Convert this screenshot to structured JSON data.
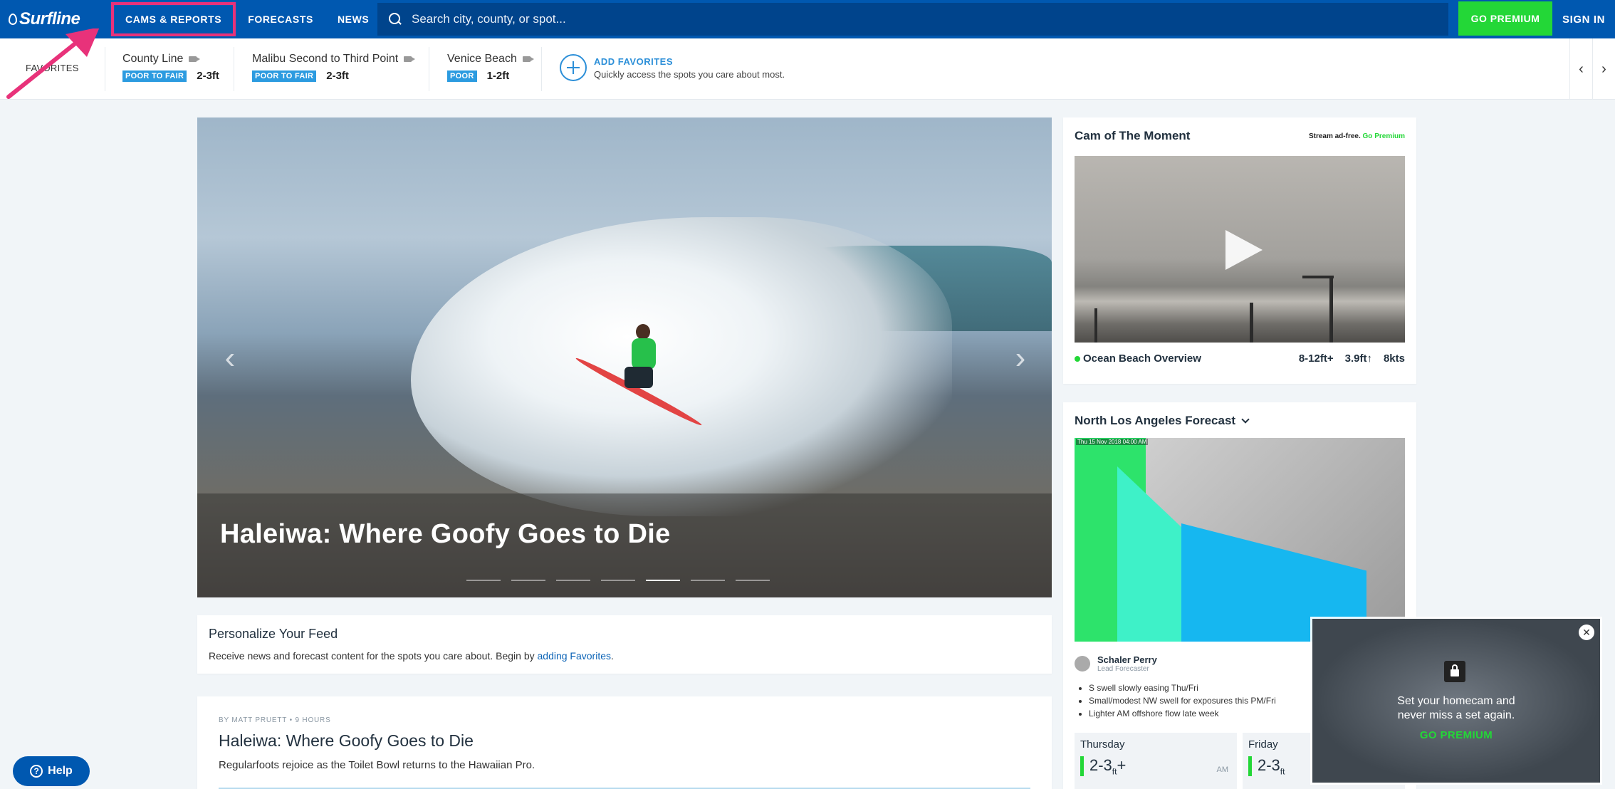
{
  "nav": {
    "logo": "Surfline",
    "links": [
      "CAMS & REPORTS",
      "FORECASTS",
      "NEWS"
    ],
    "search_placeholder": "Search city, county, or spot...",
    "premium": "GO PREMIUM",
    "signin": "SIGN IN"
  },
  "favorites": {
    "label": "FAVORITES",
    "spots": [
      {
        "name": "County Line",
        "condition": "POOR TO FAIR",
        "height": "2-3ft"
      },
      {
        "name": "Malibu Second to Third Point",
        "condition": "POOR TO FAIR",
        "height": "2-3ft"
      },
      {
        "name": "Venice Beach",
        "condition": "POOR",
        "height": "1-2ft"
      }
    ],
    "add_title": "ADD FAVORITES",
    "add_sub": "Quickly access the spots you care about most."
  },
  "hero": {
    "title": "Haleiwa: Where Goofy Goes to Die",
    "slide_count": 7,
    "active_slide": 5
  },
  "personalize": {
    "title": "Personalize Your Feed",
    "text": "Receive news and forecast content for the spots you care about. Begin by ",
    "link": "adding Favorites",
    "end": "."
  },
  "article": {
    "byline": "BY MATT PRUETT • 9 HOURS",
    "title": "Haleiwa: Where Goofy Goes to Die",
    "sub": "Regularfoots rejoice as the Toilet Bowl returns to the Hawaiian Pro."
  },
  "cam": {
    "title": "Cam of The Moment",
    "ad_text": "Stream ad-free.",
    "ad_link": "Go Premium",
    "spot": "Ocean Beach Overview",
    "surf": "8-12ft+",
    "swell": "3.9ft",
    "wind": "8kts"
  },
  "forecast": {
    "title": "North Los Angeles Forecast",
    "map_stamp": "Thu 15 Nov 2018 04:00 AM",
    "forecaster": "Schaler Perry",
    "role": "Lead Forecaster",
    "bullets": [
      "S swell slowly easing Thu/Fri",
      "Small/modest NW swell for exposures this PM/Fri",
      "Lighter AM offshore flow late week"
    ],
    "days": [
      {
        "name": "Thursday",
        "height": "2-3",
        "unit": "ft",
        "plus": "+",
        "time": "AM"
      },
      {
        "name": "Friday",
        "height": "2-3",
        "unit": "ft",
        "plus": "",
        "time": ""
      }
    ]
  },
  "popup": {
    "line1": "Set your homecam and",
    "line2": "never miss a set again.",
    "cta": "GO PREMIUM"
  },
  "help": {
    "label": "Help"
  },
  "colors": {
    "brand_blue": "#0058b0",
    "premium_green": "#23d737",
    "condition_blue": "#2c9be0",
    "annotation_pink": "#e8327a"
  }
}
